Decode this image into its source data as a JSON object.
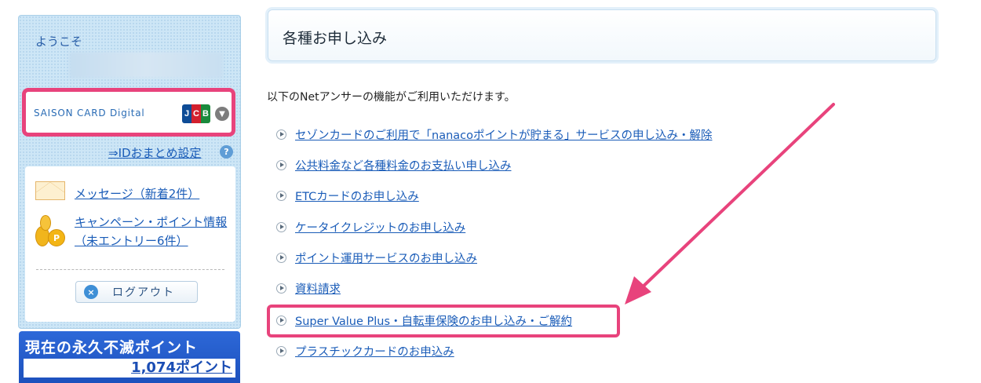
{
  "sidebar": {
    "welcome": "ようこそ",
    "card": {
      "name": "SAISON CARD Digital",
      "brand_letters": [
        "J",
        "C",
        "B"
      ]
    },
    "id_link": "⇒IDおまとめ設定",
    "help_icon": "?",
    "menu": {
      "message_link": "メッセージ（新着2件）",
      "campaign_line1": "キャンペーン・ポイント情報",
      "campaign_line2": "（未エントリー6件）",
      "coin_symbol": "P",
      "logout_label": "ログアウト",
      "logout_icon": "×"
    },
    "points": {
      "title": "現在の永久不滅ポイント",
      "value": "1,074ポイント"
    }
  },
  "main": {
    "title": "各種お申し込み",
    "intro": "以下のNetアンサーの機能がご利用いただけます。",
    "links": [
      "セゾンカードのご利用で「nanacoポイントが貯まる」サービスの申し込み・解除",
      "公共料金など各種料金のお支払い申し込み",
      "ETCカードのお申し込み",
      "ケータイクレジットのお申し込み",
      "ポイント運用サービスのお申し込み",
      "資料請求",
      "Super Value Plus・自転車保険のお申し込み・ご解約",
      "プラスチックカードのお申込み"
    ]
  },
  "colors": {
    "annotation": "#e8437c",
    "link": "#1a5cb8",
    "points_bg": "#2d68d8"
  }
}
